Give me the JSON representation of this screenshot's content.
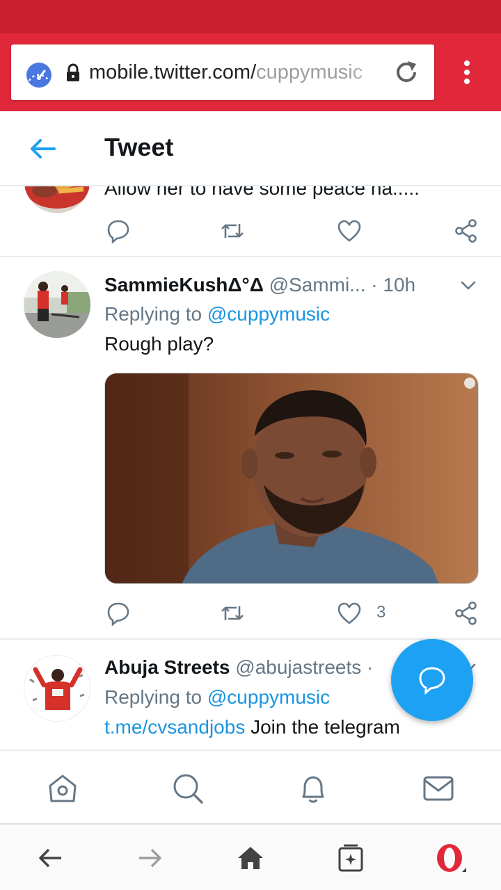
{
  "browser": {
    "url_host": "mobile.twitter.com/",
    "url_path": "cuppymusic",
    "colors": {
      "bar": "#e1283a",
      "status": "#c91f2e"
    },
    "icons": [
      "speed-dial-icon",
      "lock-icon",
      "reload-icon",
      "menu-icon"
    ]
  },
  "header": {
    "title": "Tweet"
  },
  "tweets": [
    {
      "text": "Allow her to have some peace na....."
    },
    {
      "name": "SammieKushΔ°Δ",
      "handle": "@Sammi...",
      "sep": " · ",
      "time": "10h",
      "reply_prefix": "Replying to ",
      "reply_to": "@cuppymusic",
      "text": "Rough play?",
      "like_count": "3"
    },
    {
      "name": "Abuja Streets",
      "handle": "@abujastreets",
      "sep": " ·",
      "reply_prefix": "Replying to ",
      "reply_to": "@cuppymusic",
      "link": "t.me/cvsandjobs",
      "text": " Join the telegram"
    }
  ],
  "tabbar": {
    "icons": [
      "home-icon",
      "search-icon",
      "bell-icon",
      "mail-icon"
    ]
  },
  "browser_nav": {
    "icons": [
      "back-icon",
      "forward-icon",
      "home-icon",
      "tabs-icon",
      "opera-icon"
    ]
  },
  "accent": "#1da1f2"
}
